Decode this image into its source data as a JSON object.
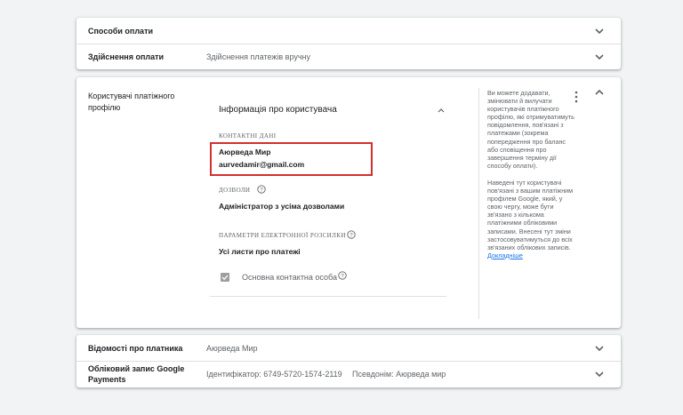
{
  "top_card": {
    "payment_methods_label": "Способи оплати",
    "make_payment_label": "Здійснення оплати",
    "make_payment_value": "Здійснення платежів вручну"
  },
  "users_card": {
    "title": "Користувачі платіжного профілю",
    "user_info_header": "Інформація про користувача",
    "contact_section_label": "КОНТАКТНІ ДАНІ",
    "contact_name": "Аюрведа Мир",
    "contact_email": "aurvedamir@gmail.com",
    "permissions_label": "ДОЗВОЛИ",
    "permissions_value": "Адміністратор з усіма дозволами",
    "email_prefs_label": "ПАРАМЕТРИ ЕЛЕКТРОННОЇ РОЗСИЛКИ",
    "email_prefs_value": "Усі листи про платежі",
    "primary_contact_label": "Основна контактна особа",
    "primary_contact_checked": true,
    "sidebar_text_1": "Ви можете додавати, змінювати й вилучати користувачів платіжного профілю, які отримуватимуть повідомлення, пов'язані з платежами (зокрема попередження про баланс або сповіщення про завершення терміну дії способу оплати).",
    "sidebar_text_2": "Наведені тут користувачі пов'язані з вашим платіжним профілем Google, який, у свою чергу, може бути зв'язано з кількома платіжними обліковими записами. Внесені тут зміни застосовуватимуться до всіх зв'язаних облікових записів.",
    "sidebar_link": "Докладніше"
  },
  "bottom_card": {
    "payer_info_label": "Відомості про платника",
    "payer_info_value": "Аюрведа Мир",
    "google_payments_label": "Обліковий запис Google Payments",
    "google_payments_id": "Ідентифікатор: 6749-5720-1574-2119",
    "google_payments_alias": "Псевдонім: Аюрведа мир"
  },
  "colors": {
    "highlight_box": "#d32f2f",
    "link": "#1a73e8",
    "background": "#f1f3f4"
  },
  "icons": [
    "chevron-down-icon",
    "chevron-up-icon",
    "help-icon",
    "more-vert-icon",
    "checkbox-checked-icon"
  ]
}
